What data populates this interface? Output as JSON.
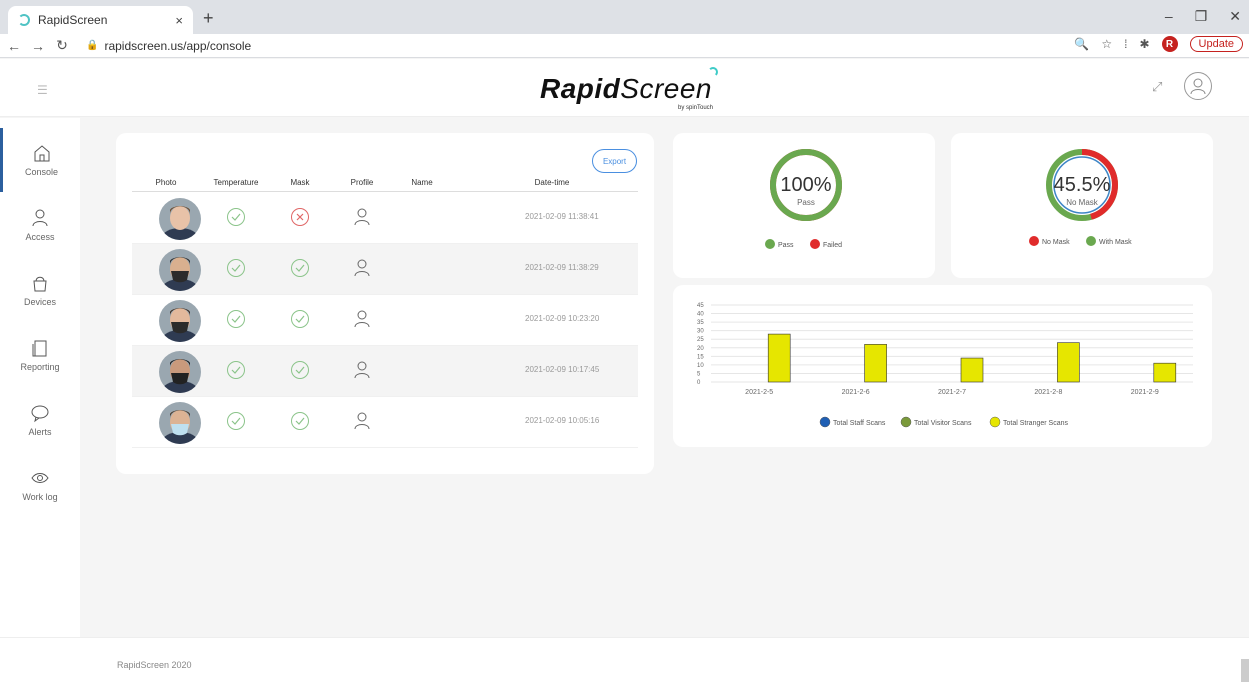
{
  "browser": {
    "tab_title": "RapidScreen",
    "tab_close": "×",
    "new_tab": "+",
    "url": "rapidscreen.us/app/console",
    "profile_initial": "R",
    "update_label": "Update"
  },
  "header": {
    "logo_bold": "Rapid",
    "logo_rest": "Screen",
    "logo_sub": "by spinTouch"
  },
  "sidebar": {
    "items": [
      {
        "label": "Console",
        "icon": "home-icon",
        "active": true
      },
      {
        "label": "Access",
        "icon": "user-icon"
      },
      {
        "label": "Devices",
        "icon": "device-icon"
      },
      {
        "label": "Reporting",
        "icon": "report-icon"
      },
      {
        "label": "Alerts",
        "icon": "chat-icon"
      },
      {
        "label": "Work log",
        "icon": "eye-icon"
      }
    ]
  },
  "table": {
    "export_label": "Export",
    "columns": [
      "Photo",
      "Temperature",
      "Mask",
      "Profile",
      "Name",
      "Date-time"
    ],
    "rows": [
      {
        "temperature": "pass",
        "mask": "fail",
        "name": "",
        "datetime": "2021-02-09 11:38:41"
      },
      {
        "temperature": "pass",
        "mask": "pass",
        "name": "",
        "datetime": "2021-02-09 11:38:29"
      },
      {
        "temperature": "pass",
        "mask": "pass",
        "name": "",
        "datetime": "2021-02-09 10:23:20"
      },
      {
        "temperature": "pass",
        "mask": "pass",
        "name": "",
        "datetime": "2021-02-09 10:17:45"
      },
      {
        "temperature": "pass",
        "mask": "pass",
        "name": "",
        "datetime": "2021-02-09 10:05:16"
      }
    ]
  },
  "pass_donut": {
    "value_text": "100%",
    "label": "Pass",
    "pass_fraction": 1.0,
    "legend": [
      {
        "name": "Pass",
        "color": "#6aa84f"
      },
      {
        "name": "Failed",
        "color": "#e02b2b"
      }
    ]
  },
  "mask_donut": {
    "value_text": "45.5%",
    "label": "No Mask",
    "no_mask_fraction": 0.455,
    "legend": [
      {
        "name": "No Mask",
        "color": "#e02b2b"
      },
      {
        "name": "With Mask",
        "color": "#6aa84f"
      }
    ]
  },
  "chart_data": {
    "type": "bar",
    "categories": [
      "2021-2-5",
      "2021-2-6",
      "2021-2-7",
      "2021-2-8",
      "2021-2-9"
    ],
    "series": [
      {
        "name": "Total Staff Scans",
        "color": "#1f5fb4",
        "values": [
          0,
          0,
          0,
          0,
          0
        ]
      },
      {
        "name": "Total Visitor Scans",
        "color": "#7a9a3a",
        "values": [
          0,
          0,
          0,
          0,
          0
        ]
      },
      {
        "name": "Total Stranger Scans",
        "color": "#e6e600",
        "values": [
          28,
          22,
          14,
          23,
          11
        ]
      }
    ],
    "yticks": [
      0,
      5,
      10,
      15,
      20,
      25,
      30,
      35,
      40,
      45
    ],
    "ylim": [
      0,
      45
    ],
    "grid": true,
    "legend_position": "bottom"
  },
  "footer": {
    "text": "RapidScreen 2020"
  }
}
